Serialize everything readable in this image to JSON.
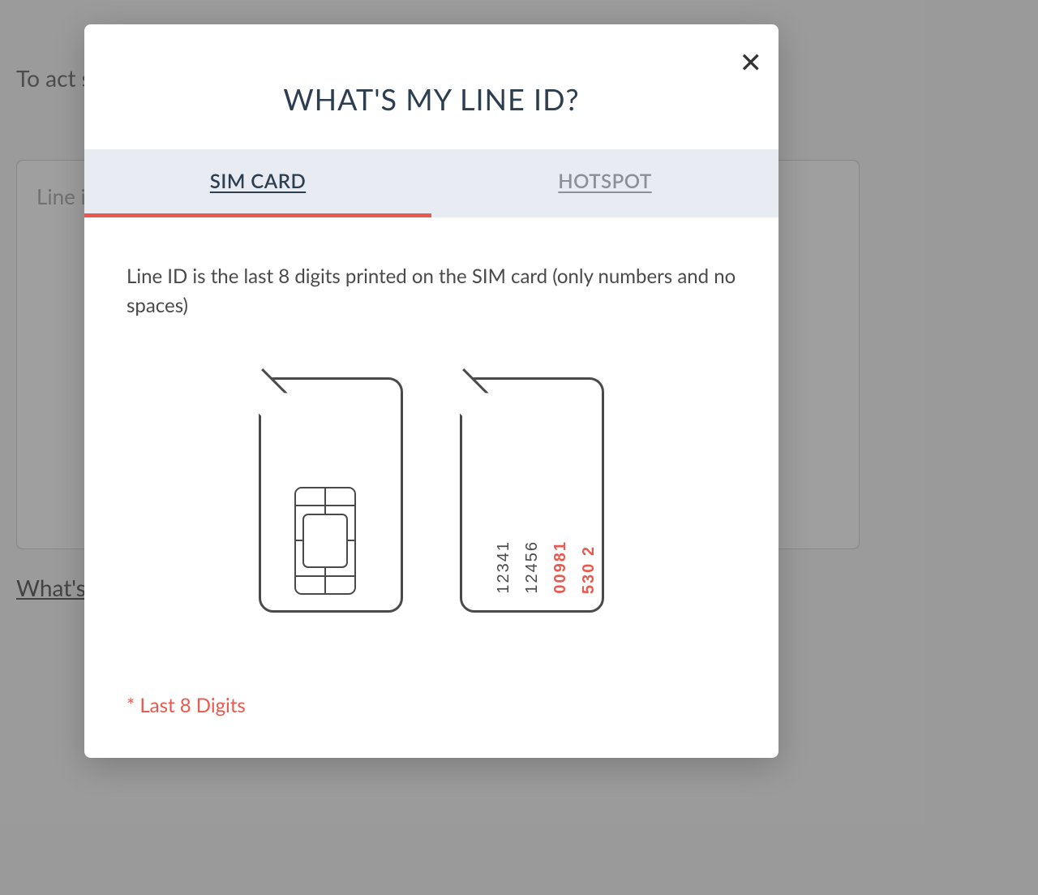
{
  "background": {
    "intro_text": "To act separa",
    "textarea_placeholder": "Line i",
    "help_link": "What's"
  },
  "modal": {
    "title": "WHAT'S MY LINE ID?",
    "tabs": {
      "sim_card": "SIM CARD",
      "hotspot": "HOTSPOT"
    },
    "description": "Line ID is the last 8 digits printed on the SIM card (only numbers and no spaces)",
    "sim_numbers": {
      "col1": "12341",
      "col2": "12456",
      "col3": "00981",
      "col4": "530 2"
    },
    "note": "* Last 8 Digits"
  }
}
